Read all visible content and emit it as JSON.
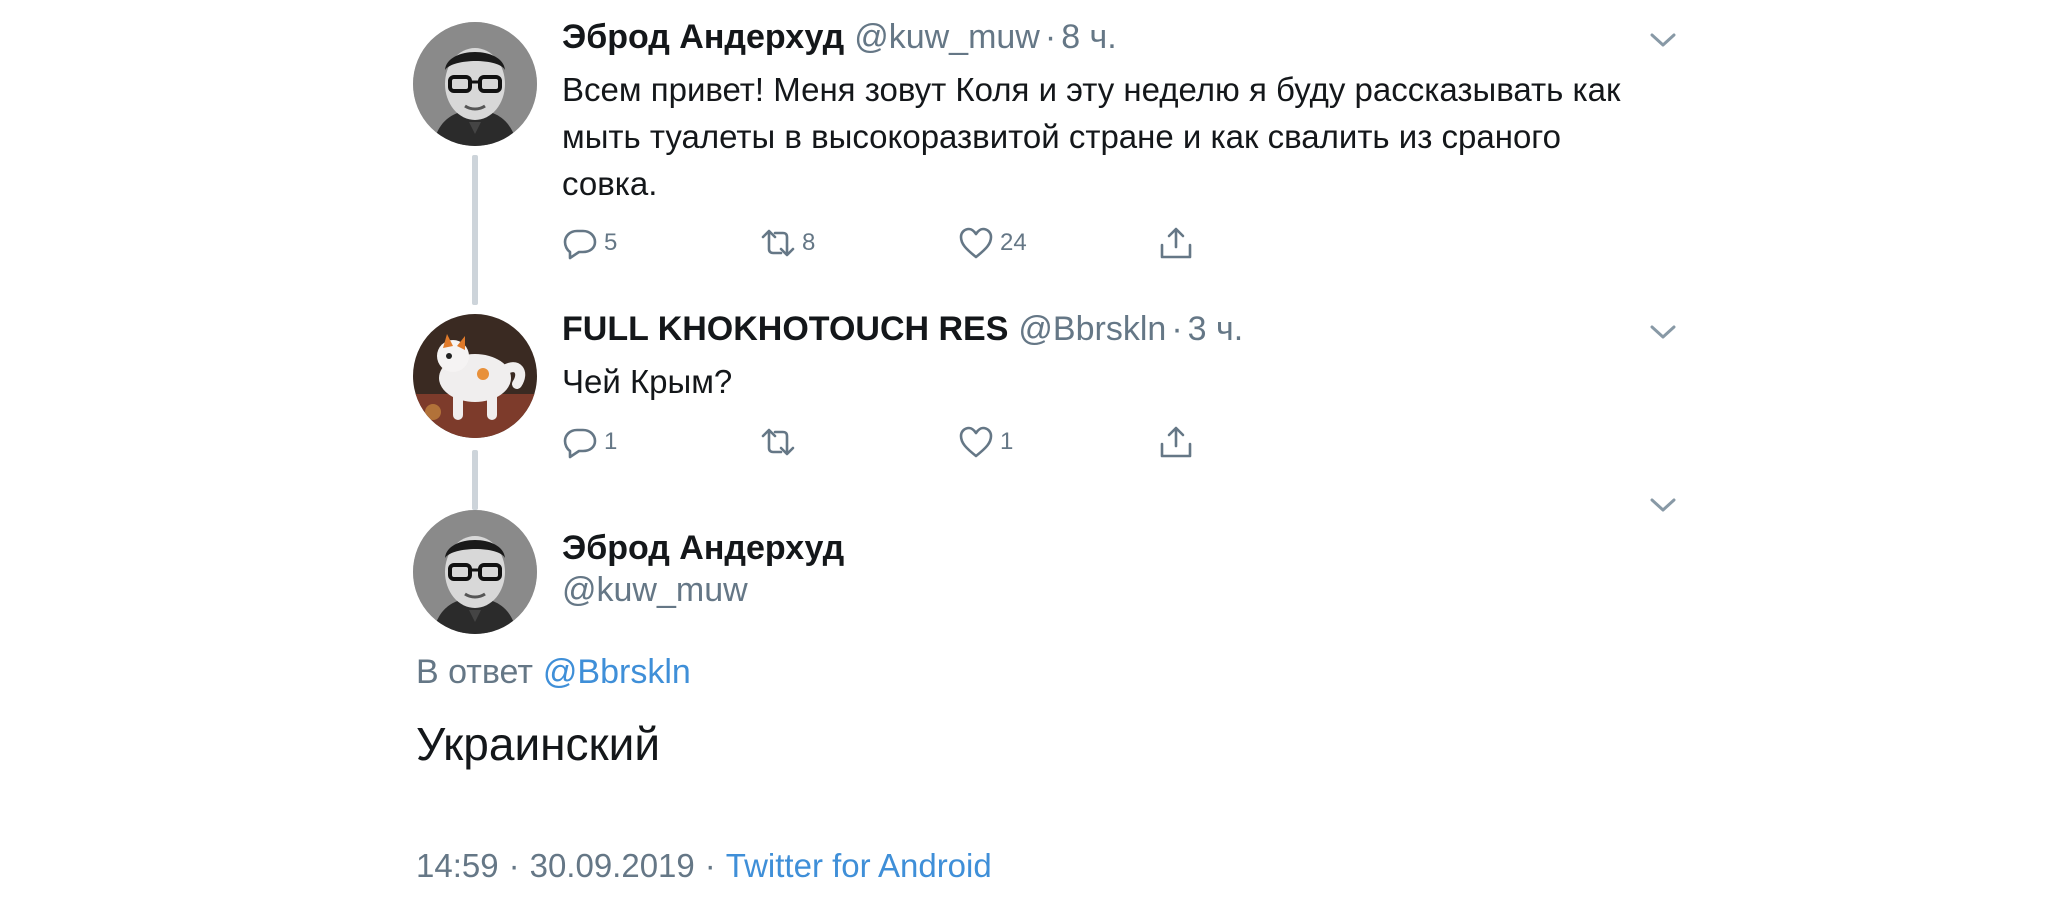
{
  "tweets": [
    {
      "name": "Эброд Андерхуд",
      "handle": "@kuw_muw",
      "sep": "·",
      "time": "8 ч.",
      "text": "Всем привет! Меня зовут Коля и эту неделю я буду рассказывать как мыть туалеты в высокоразвитой стране и как свалить из сраного совка.",
      "replies": "5",
      "retweets": "8",
      "likes": "24"
    },
    {
      "name": "FULL KHOKHOTOUCH RES",
      "handle": "@Bbrskln",
      "sep": "·",
      "time": "3 ч.",
      "text": "Чей Крым?",
      "replies": "1",
      "retweets": "",
      "likes": "1"
    }
  ],
  "main": {
    "name": "Эброд Андерхуд",
    "handle": "@kuw_muw",
    "reply_prefix": "В ответ",
    "reply_to": "@Bbrskln",
    "text": "Украинский",
    "time": "14:59",
    "date": "30.09.2019",
    "sep": "·",
    "source": "Twitter for Android"
  },
  "icons": {
    "reply": "reply-icon",
    "retweet": "retweet-icon",
    "like": "heart-icon",
    "share": "share-icon",
    "more": "chevron-down-icon"
  },
  "colors": {
    "text": "#14171a",
    "secondary": "#657786",
    "link": "#3f8fd8",
    "thread_line": "#cdd4da"
  }
}
